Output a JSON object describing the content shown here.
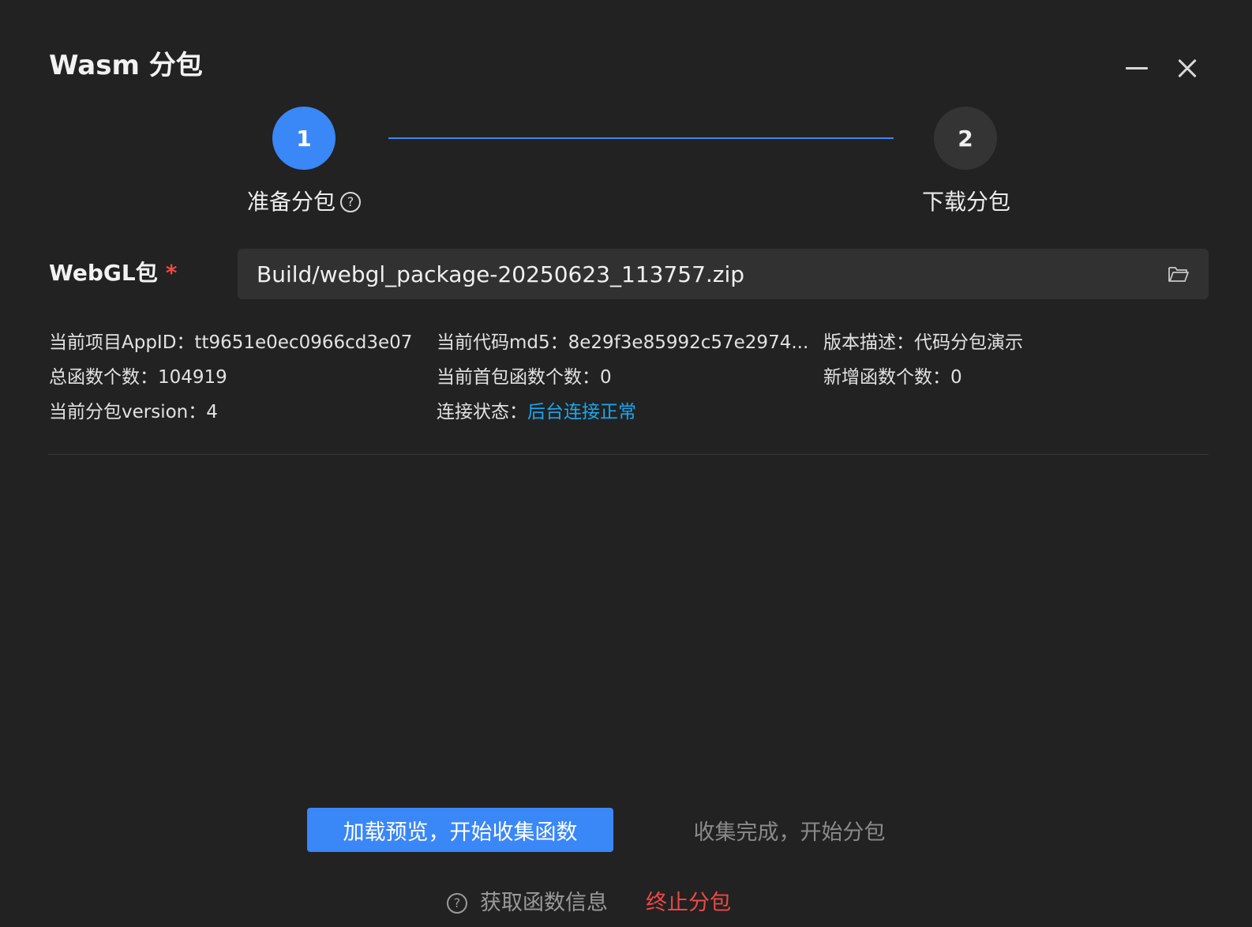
{
  "window": {
    "title": "Wasm 分包",
    "minimize_icon": "minimize-icon",
    "close_icon": "close-icon"
  },
  "steps": [
    {
      "number": "1",
      "label": "准备分包",
      "active": true,
      "help_icon": "question-circle-icon"
    },
    {
      "number": "2",
      "label": "下载分包",
      "active": false
    }
  ],
  "webgl_field": {
    "label": "WebGL包",
    "required_mark": "*",
    "value": "Build/webgl_package-20250623_113757.zip",
    "icon": "folder-open-icon"
  },
  "info": {
    "app_id": "当前项目AppID：tt9651e0ec0966cd3e07",
    "md5": "当前代码md5：8e29f3e85992c57e2974...",
    "version_desc": "版本描述：代码分包演示",
    "total_functions": "总函数个数：104919",
    "first_package_functions": "当前首包函数个数：0",
    "new_functions": "新增函数个数：0",
    "package_version": "当前分包version：4",
    "connection_label": "连接状态：",
    "connection_status": "后台连接正常"
  },
  "actions": {
    "primary": "加载预览，开始收集函数",
    "secondary": "收集完成，开始分包",
    "fetch_info": "获取函数信息",
    "stop": "终止分包"
  },
  "colors": {
    "accent": "#3a87f7",
    "status_ok": "#1aa8ee",
    "danger": "#f04747",
    "background": "#222222"
  }
}
